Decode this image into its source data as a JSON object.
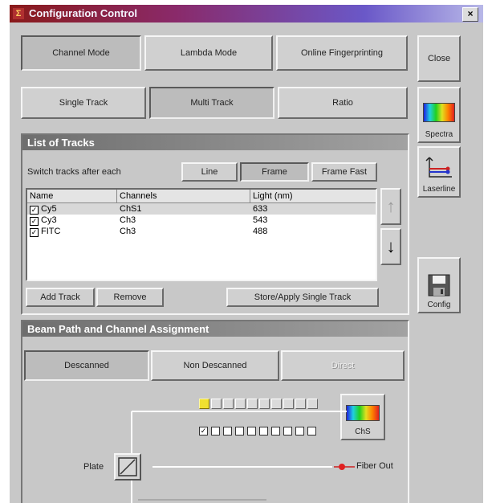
{
  "window": {
    "title": "Configuration Control",
    "close_glyph": "×",
    "app_icon_glyph": "Σ"
  },
  "mode_tabs": [
    {
      "label": "Channel Mode",
      "pressed": true
    },
    {
      "label": "Lambda Mode",
      "pressed": false
    },
    {
      "label": "Online Fingerprinting",
      "pressed": false
    }
  ],
  "track_tabs": [
    {
      "label": "Single Track",
      "pressed": false
    },
    {
      "label": "Multi Track",
      "pressed": true
    },
    {
      "label": "Ratio",
      "pressed": false
    }
  ],
  "sidebar": {
    "close_label": "Close",
    "spectra_label": "Spectra",
    "laserline_label": "Laserline",
    "config_label": "Config"
  },
  "tracks": {
    "header": "List of Tracks",
    "switch_label": "Switch tracks after each",
    "switch_options": [
      {
        "label": "Line",
        "pressed": false
      },
      {
        "label": "Frame",
        "pressed": true
      },
      {
        "label": "Frame Fast",
        "pressed": false
      }
    ],
    "columns": [
      "Name",
      "Channels",
      "Light (nm)"
    ],
    "rows": [
      {
        "name": "Cy5",
        "channels": "ChS1",
        "light": "633",
        "checked": true,
        "selected": true
      },
      {
        "name": "Cy3",
        "channels": "Ch3",
        "light": "543",
        "checked": true,
        "selected": false
      },
      {
        "name": "FITC",
        "channels": "Ch3",
        "light": "488",
        "checked": true,
        "selected": false
      }
    ],
    "check_glyph": "✓",
    "up_arrow": "↑",
    "down_arrow": "↓",
    "add_label": "Add Track",
    "remove_label": "Remove",
    "store_label": "Store/Apply Single Track"
  },
  "beam": {
    "header": "Beam Path and Channel Assignment",
    "tabs": [
      {
        "label": "Descanned",
        "pressed": true,
        "disabled": false
      },
      {
        "label": "Non Descanned",
        "pressed": false,
        "disabled": false
      },
      {
        "label": "Direct",
        "pressed": false,
        "disabled": true
      }
    ],
    "channel_button_label": "ChS",
    "plate_label": "Plate",
    "fiber_label": "Fiber Out"
  },
  "colors": {
    "accent_yellow": "#f0e030",
    "fiber_dot": "#e02020"
  }
}
